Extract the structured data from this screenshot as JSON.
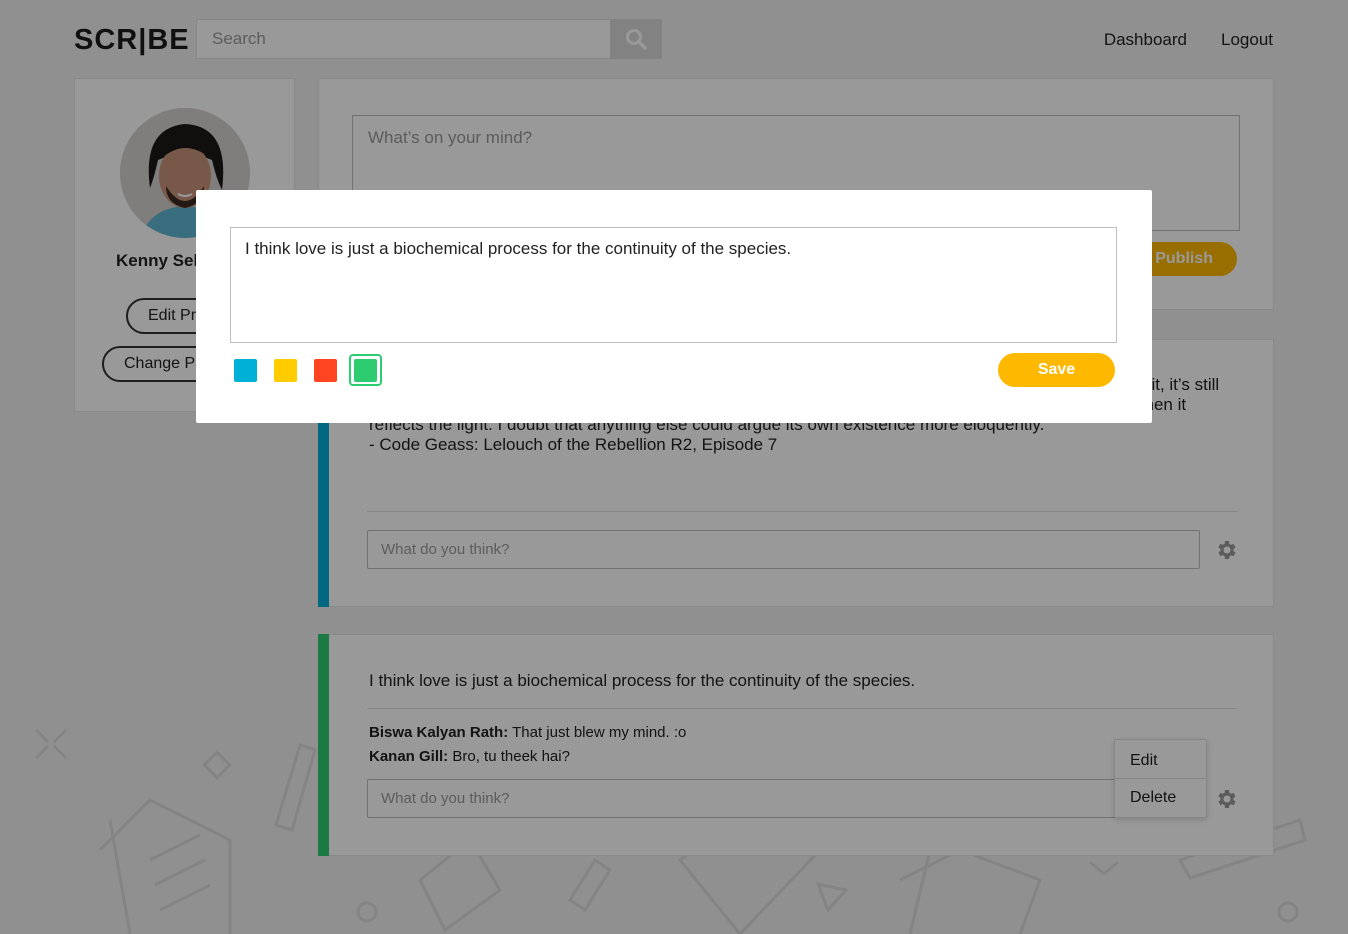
{
  "header": {
    "logo": "SCR|BE",
    "search_placeholder": "Search",
    "nav": [
      "Dashboard",
      "Logout"
    ]
  },
  "profile": {
    "name": "Kenny Sebastian",
    "edit_profile_label": "Edit Profile",
    "change_password_label": "Change Password"
  },
  "composer": {
    "placeholder": "What’s on your mind?",
    "publish_label": "Publish"
  },
  "posts": [
    {
      "accent_color": "#00b0d7",
      "text": "Speaking of true love, I think it is like a glass of water. He said that even though you don’t usually notice it, it’s still definitely there. You merely have to change your point of view slightly, and then that glass will sparkle when it reflects the light. I doubt that anything else could argue its own existence more eloquently.\n- Code Geass: Lelouch of the Rebellion R2, Episode 7",
      "comment_placeholder": "What do you think?",
      "comments": []
    },
    {
      "accent_color": "#2ecc71",
      "text": "I think love is just a biochemical process for the continuity of the species.",
      "comment_placeholder": "What do you think?",
      "comments": [
        {
          "author": "Biswa Kalyan Rath:",
          "text": "That just blew my mind. :o"
        },
        {
          "author": "Kanan Gill:",
          "text": "Bro, tu theek hai?"
        }
      ]
    }
  ],
  "post_menu": {
    "items": [
      "Edit",
      "Delete"
    ]
  },
  "edit_modal": {
    "text": "I think love is just a biochemical process for the continuity of the species.",
    "colors": [
      "#00b0d7",
      "#ffcc00",
      "#ff4422",
      "#2ecc71"
    ],
    "selected_color": "#2ecc71",
    "save_label": "Save"
  },
  "icons": {
    "search": "search-icon",
    "settings": "gear-icon"
  }
}
